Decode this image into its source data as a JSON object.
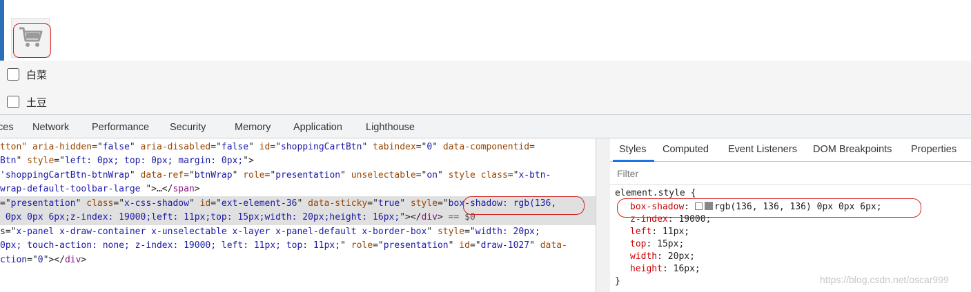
{
  "page": {
    "veg_items": [
      {
        "label": "白菜"
      },
      {
        "label": "土豆"
      }
    ]
  },
  "devtools": {
    "tabs": [
      "ces",
      "Network",
      "Performance",
      "Security",
      "Memory",
      "Application",
      "Lighthouse"
    ],
    "elements": {
      "lines": [
        {
          "parts": [
            {
              "c": "a",
              "t": "tton\""
            },
            {
              "c": "p",
              "t": " "
            },
            {
              "c": "a",
              "t": "aria-hidden"
            },
            {
              "c": "p",
              "t": "=\""
            },
            {
              "c": "v",
              "t": "false"
            },
            {
              "c": "p",
              "t": "\" "
            },
            {
              "c": "a",
              "t": "aria-disabled"
            },
            {
              "c": "p",
              "t": "=\""
            },
            {
              "c": "v",
              "t": "false"
            },
            {
              "c": "p",
              "t": "\" "
            },
            {
              "c": "a",
              "t": "id"
            },
            {
              "c": "p",
              "t": "=\""
            },
            {
              "c": "v",
              "t": "shoppingCartBtn"
            },
            {
              "c": "p",
              "t": "\" "
            },
            {
              "c": "a",
              "t": "tabindex"
            },
            {
              "c": "p",
              "t": "=\""
            },
            {
              "c": "v",
              "t": "0"
            },
            {
              "c": "p",
              "t": "\" "
            },
            {
              "c": "a",
              "t": "data-componentid"
            },
            {
              "c": "p",
              "t": "="
            }
          ]
        },
        {
          "parts": [
            {
              "c": "v",
              "t": "Btn"
            },
            {
              "c": "p",
              "t": "\" "
            },
            {
              "c": "a",
              "t": "style"
            },
            {
              "c": "p",
              "t": "=\""
            },
            {
              "c": "v",
              "t": "left: 0px; top: 0px; margin: 0px;"
            },
            {
              "c": "p",
              "t": "\">"
            }
          ]
        },
        {
          "parts": [
            {
              "c": "v",
              "t": "'shoppingCartBtn-btnWrap"
            },
            {
              "c": "p",
              "t": "\" "
            },
            {
              "c": "a",
              "t": "data-ref"
            },
            {
              "c": "p",
              "t": "=\""
            },
            {
              "c": "v",
              "t": "btnWrap"
            },
            {
              "c": "p",
              "t": "\" "
            },
            {
              "c": "a",
              "t": "role"
            },
            {
              "c": "p",
              "t": "=\""
            },
            {
              "c": "v",
              "t": "presentation"
            },
            {
              "c": "p",
              "t": "\" "
            },
            {
              "c": "a",
              "t": "unselectable"
            },
            {
              "c": "p",
              "t": "=\""
            },
            {
              "c": "v",
              "t": "on"
            },
            {
              "c": "p",
              "t": "\" "
            },
            {
              "c": "a",
              "t": "style"
            },
            {
              "c": "p",
              "t": " "
            },
            {
              "c": "a",
              "t": "class"
            },
            {
              "c": "p",
              "t": "=\""
            },
            {
              "c": "v",
              "t": "x-btn-"
            }
          ]
        },
        {
          "parts": [
            {
              "c": "v",
              "t": "wrap-default-toolbar-large "
            },
            {
              "c": "p",
              "t": "\">…</"
            },
            {
              "c": "t",
              "t": "span"
            },
            {
              "c": "p",
              "t": ">"
            }
          ]
        },
        {
          "parts": [
            {
              "c": "p",
              "t": "=\""
            },
            {
              "c": "v",
              "t": "presentation"
            },
            {
              "c": "p",
              "t": "\" "
            },
            {
              "c": "a",
              "t": "class"
            },
            {
              "c": "p",
              "t": "=\""
            },
            {
              "c": "v",
              "t": "x-css-shadow"
            },
            {
              "c": "p",
              "t": "\" "
            },
            {
              "c": "a",
              "t": "id"
            },
            {
              "c": "p",
              "t": "=\""
            },
            {
              "c": "v",
              "t": "ext-element-36"
            },
            {
              "c": "p",
              "t": "\" "
            },
            {
              "c": "a",
              "t": "data-sticky"
            },
            {
              "c": "p",
              "t": "=\""
            },
            {
              "c": "v",
              "t": "true"
            },
            {
              "c": "p",
              "t": "\" "
            },
            {
              "c": "a",
              "t": "style"
            },
            {
              "c": "p",
              "t": "=\""
            },
            {
              "c": "v",
              "t": "box-shadow: rgb(136,"
            }
          ]
        },
        {
          "parts": [
            {
              "c": "v",
              "t": " 0px 0px 6px;z-index: 19000;left: 11px;top: 15px;width: 20px;height: 16px;"
            },
            {
              "c": "p",
              "t": "\"></"
            },
            {
              "c": "t",
              "t": "div"
            },
            {
              "c": "p",
              "t": "> "
            },
            {
              "c": "g",
              "t": "== $0"
            }
          ]
        },
        {
          "parts": [
            {
              "c": "p",
              "t": "s=\""
            },
            {
              "c": "v",
              "t": "x-panel x-draw-container x-unselectable x-layer x-panel-default x-border-box"
            },
            {
              "c": "p",
              "t": "\" "
            },
            {
              "c": "a",
              "t": "style"
            },
            {
              "c": "p",
              "t": "=\""
            },
            {
              "c": "v",
              "t": "width: 20px;"
            }
          ]
        },
        {
          "parts": [
            {
              "c": "v",
              "t": "0px; touch-action: none; z-index: 19000; left: 11px; top: 11px;"
            },
            {
              "c": "p",
              "t": "\" "
            },
            {
              "c": "a",
              "t": "role"
            },
            {
              "c": "p",
              "t": "=\""
            },
            {
              "c": "v",
              "t": "presentation"
            },
            {
              "c": "p",
              "t": "\" "
            },
            {
              "c": "a",
              "t": "id"
            },
            {
              "c": "p",
              "t": "=\""
            },
            {
              "c": "v",
              "t": "draw-1027"
            },
            {
              "c": "p",
              "t": "\" "
            },
            {
              "c": "a",
              "t": "data-"
            }
          ]
        },
        {
          "parts": [
            {
              "c": "v",
              "t": "ction"
            },
            {
              "c": "p",
              "t": "=\""
            },
            {
              "c": "v",
              "t": "0"
            },
            {
              "c": "p",
              "t": "\"></"
            },
            {
              "c": "t",
              "t": "div"
            },
            {
              "c": "p",
              "t": ">"
            }
          ]
        }
      ]
    },
    "styles": {
      "sub_tabs": [
        "Styles",
        "Computed",
        "Event Listeners",
        "DOM Breakpoints",
        "Properties"
      ],
      "filter_placeholder": "Filter",
      "selector": "element.style {",
      "close_brace": "}",
      "declarations": [
        {
          "prop": "box-shadow",
          "value": "rgb(136, 136, 136) 0px 0px 6px;",
          "swatch": "#888888"
        },
        {
          "prop": "z-index",
          "value": "19000;"
        },
        {
          "prop": "left",
          "value": "11px;"
        },
        {
          "prop": "top",
          "value": "15px;"
        },
        {
          "prop": "width",
          "value": "20px;"
        },
        {
          "prop": "height",
          "value": "16px;"
        }
      ]
    }
  },
  "watermark": "https://blog.csdn.net/oscar999"
}
